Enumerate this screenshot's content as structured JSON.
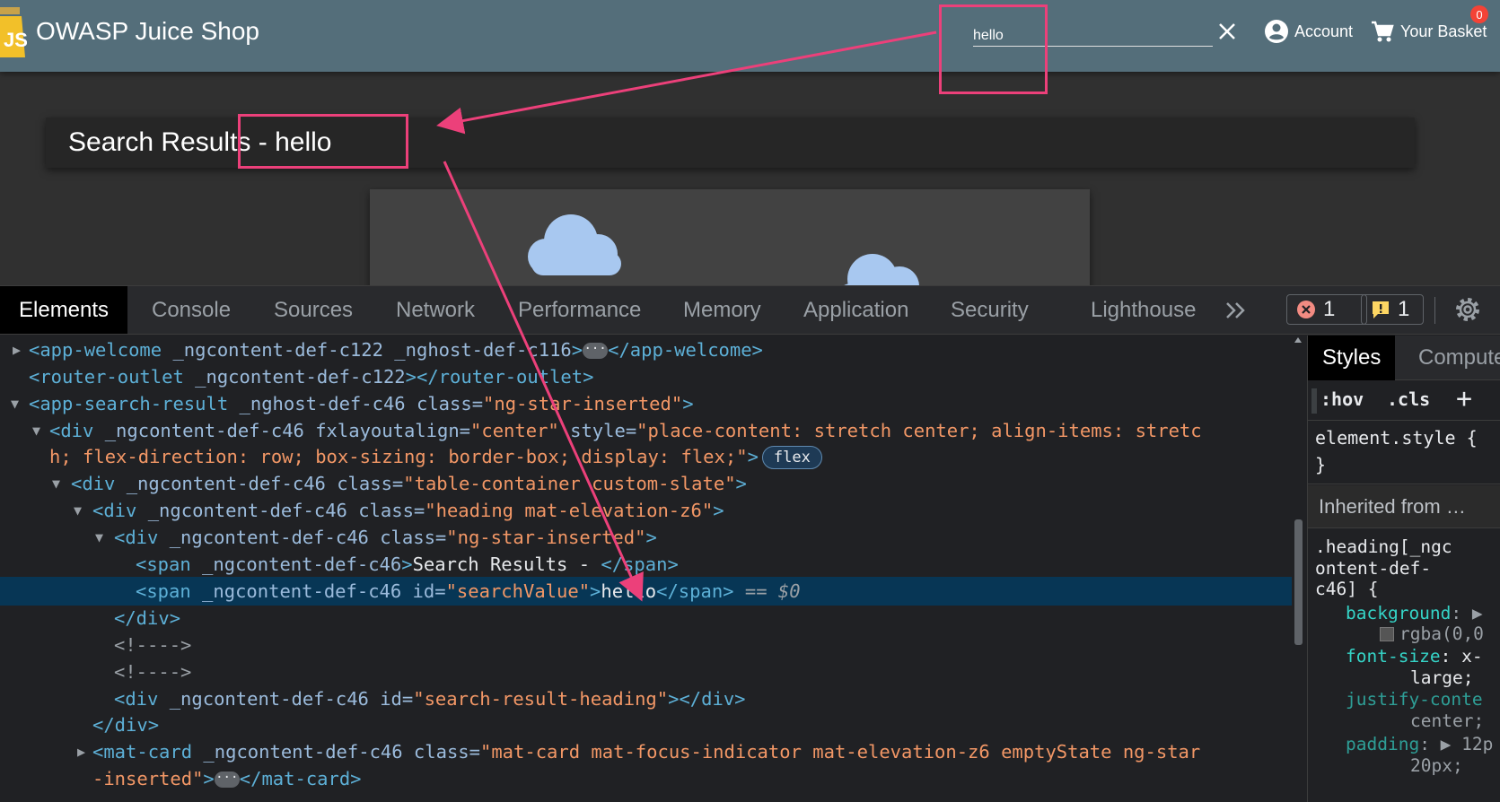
{
  "app": {
    "title": "OWASP Juice Shop",
    "search": {
      "value": "hello"
    },
    "account_label": "Account",
    "basket_label": "Your Basket",
    "basket_count": "0",
    "heading_prefix": "Search Results - ",
    "heading_value": "hello"
  },
  "devtools": {
    "tabs": [
      "Elements",
      "Console",
      "Sources",
      "Network",
      "Performance",
      "Memory",
      "Application",
      "Security",
      "Lighthouse"
    ],
    "error_count": "1",
    "warning_count": "1",
    "tree": {
      "l0": {
        "open": "<app-welcome",
        "attrs": " _ngcontent-def-c122 _nghost-def-c116",
        "close_open": ">",
        "end": "</app-welcome>"
      },
      "l1": {
        "tag": "<router-outlet",
        "attrs": " _ngcontent-def-c122",
        "close": "></router-outlet>"
      },
      "l2": {
        "tag": "<app-search-result",
        "attr1": " _nghost-def-c46 class=",
        "val1": "\"ng-star-inserted\"",
        "gt": ">"
      },
      "l3": {
        "tag": "<div",
        "attr1": " _ngcontent-def-c46 fxlayoutalign=",
        "val1": "\"center\"",
        "attr2": " style=",
        "val2": "\"place-content: stretch center; align-items: stretc"
      },
      "l3b": {
        "val": "h; flex-direction: row; box-sizing: border-box; display: flex;\"",
        "gt": ">",
        "badge": "flex"
      },
      "l4": {
        "tag": "<div",
        "attr1": " _ngcontent-def-c46 class=",
        "val1": "\"table-container custom-slate\"",
        "gt": ">"
      },
      "l5": {
        "tag": "<div",
        "attr1": " _ngcontent-def-c46 class=",
        "val1": "\"heading mat-elevation-z6\"",
        "gt": ">"
      },
      "l6": {
        "tag": "<div",
        "attr1": " _ngcontent-def-c46 class=",
        "val1": "\"ng-star-inserted\"",
        "gt": ">"
      },
      "l7": {
        "tag": "<span",
        "attr1": " _ngcontent-def-c46",
        "gt": ">",
        "text": "Search Results - ",
        "end": "</span>"
      },
      "l8": {
        "tag": "<span",
        "attr1": " _ngcontent-def-c46 id=",
        "val1": "\"searchValue\"",
        "gt": ">",
        "text": "hello",
        "end": "</span>",
        "eq": " == $0"
      },
      "l9": {
        "end": "</div>"
      },
      "l10": {
        "comment": "<!---->"
      },
      "l11": {
        "comment": "<!---->"
      },
      "l12": {
        "tag": "<div",
        "attr1": " _ngcontent-def-c46 id=",
        "val1": "\"search-result-heading\"",
        "end": "></div>"
      },
      "l13": {
        "end": "</div>"
      },
      "l14": {
        "tag": "<mat-card",
        "attr1": " _ngcontent-def-c46 class=",
        "val1": "\"mat-card mat-focus-indicator mat-elevation-z6 emptyState ng-star"
      },
      "l15": {
        "val": "-inserted\"",
        "gt": ">",
        "end": "</mat-card>"
      }
    },
    "styles": {
      "tab_styles": "Styles",
      "tab_computed": "Computed",
      "hov": ":hov",
      "cls": ".cls",
      "element_style": "element.style {",
      "element_style_close": "}",
      "inherited": "Inherited from …",
      "rule_sel_1": ".heading[_ngc",
      "rule_sel_2": "ontent-def-",
      "rule_sel_3": "c46] {",
      "p1_name": "background",
      "p1_val": "rgba(0,0",
      "p2_name": "font-size",
      "p2_val": "x-",
      "p2_val2": "large;",
      "p3_name": "justify-conte",
      "p3_val": "center;",
      "p4_name": "padding",
      "p4_val": "12p",
      "p4_val2": "20px;"
    }
  },
  "colors": {
    "annotation": "#ec407a",
    "toolbar": "#546e7a",
    "selected_row": "#073655"
  }
}
